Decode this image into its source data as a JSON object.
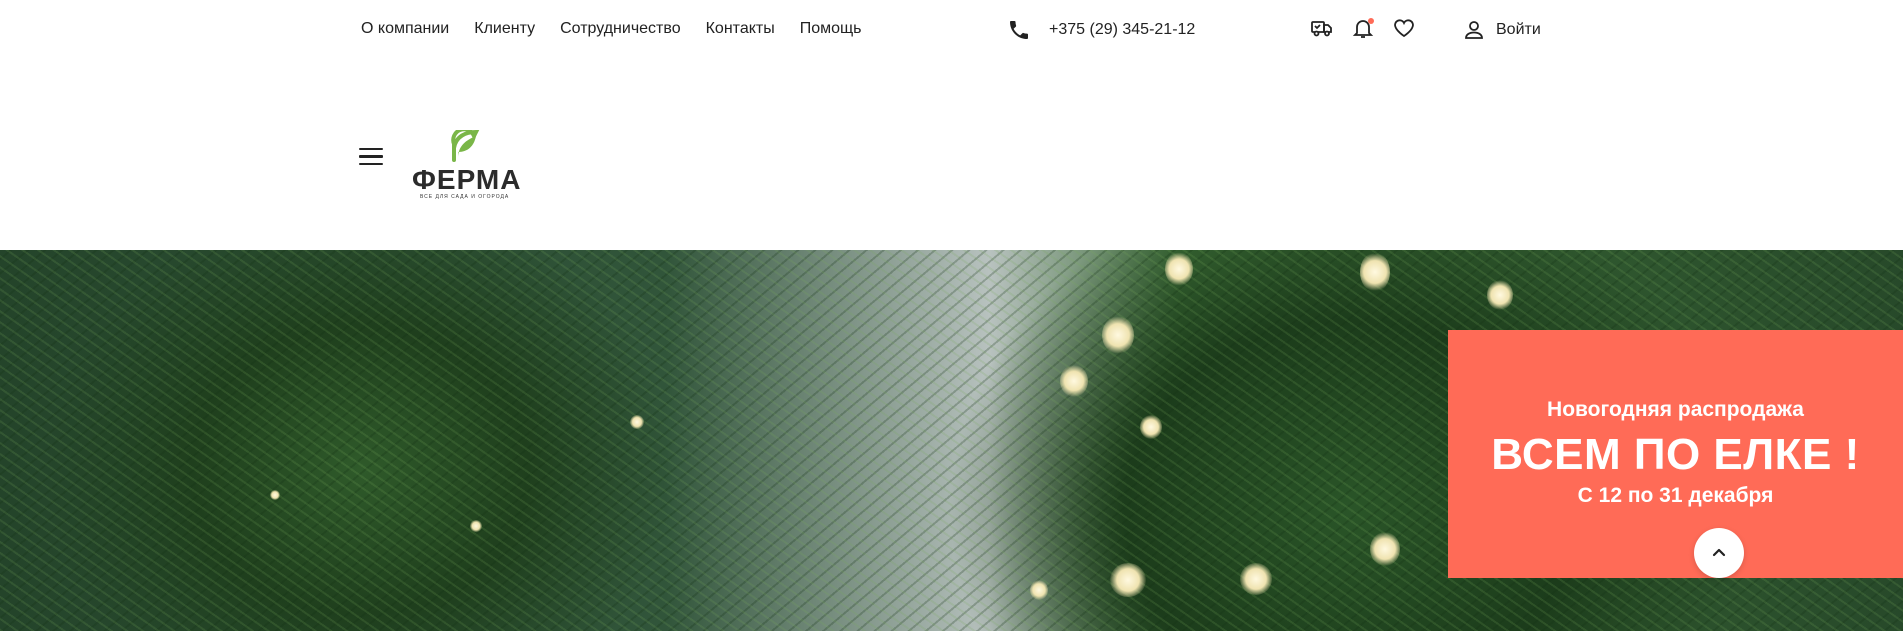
{
  "nav": {
    "items": [
      "О компании",
      "Клиенту",
      "Сотрудничество",
      "Контакты",
      "Помощь"
    ]
  },
  "contact": {
    "phone": "+375 (29) 345-21-12",
    "phone_icon": "phone-icon"
  },
  "header_icons": [
    "delivery-truck-icon",
    "bell-icon",
    "heart-icon"
  ],
  "account": {
    "login_label": "Войти",
    "icon": "user-icon"
  },
  "logo": {
    "name": "ФЕРМА",
    "tagline": "ВСЕ ДЛЯ САДА И ОГОРОДА",
    "accent_color": "#7ab648"
  },
  "promo": {
    "subtitle": "Новогодняя распродажа",
    "title": "ВСЕМ ПО ЕЛКЕ !",
    "dates": "С 12 по 31 декабря",
    "background_color": "#ff6b57"
  },
  "colors": {
    "notification_dot": "#ff6b57",
    "text": "#222222"
  }
}
